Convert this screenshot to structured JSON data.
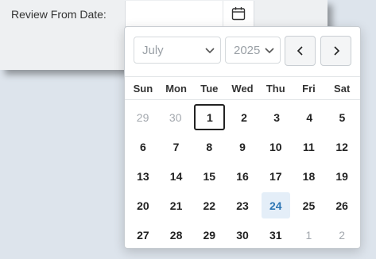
{
  "form": {
    "review_from_label": "Review From Date:"
  },
  "calendar": {
    "month": "July",
    "year": "2025",
    "weekdays": [
      "Sun",
      "Mon",
      "Tue",
      "Wed",
      "Thu",
      "Fri",
      "Sat"
    ],
    "weeks": [
      [
        "29",
        "30",
        "1",
        "2",
        "3",
        "4",
        "5"
      ],
      [
        "6",
        "7",
        "8",
        "9",
        "10",
        "11",
        "12"
      ],
      [
        "13",
        "14",
        "15",
        "16",
        "17",
        "18",
        "19"
      ],
      [
        "20",
        "21",
        "22",
        "23",
        "24",
        "25",
        "26"
      ],
      [
        "27",
        "28",
        "29",
        "30",
        "31",
        "1",
        "2"
      ]
    ],
    "selected_day": "1",
    "today_day": "24",
    "icons": {
      "calendar": "calendar-icon",
      "prev": "chevron-left-icon",
      "next": "chevron-right-icon",
      "dropdown": "chevron-down-icon"
    }
  }
}
